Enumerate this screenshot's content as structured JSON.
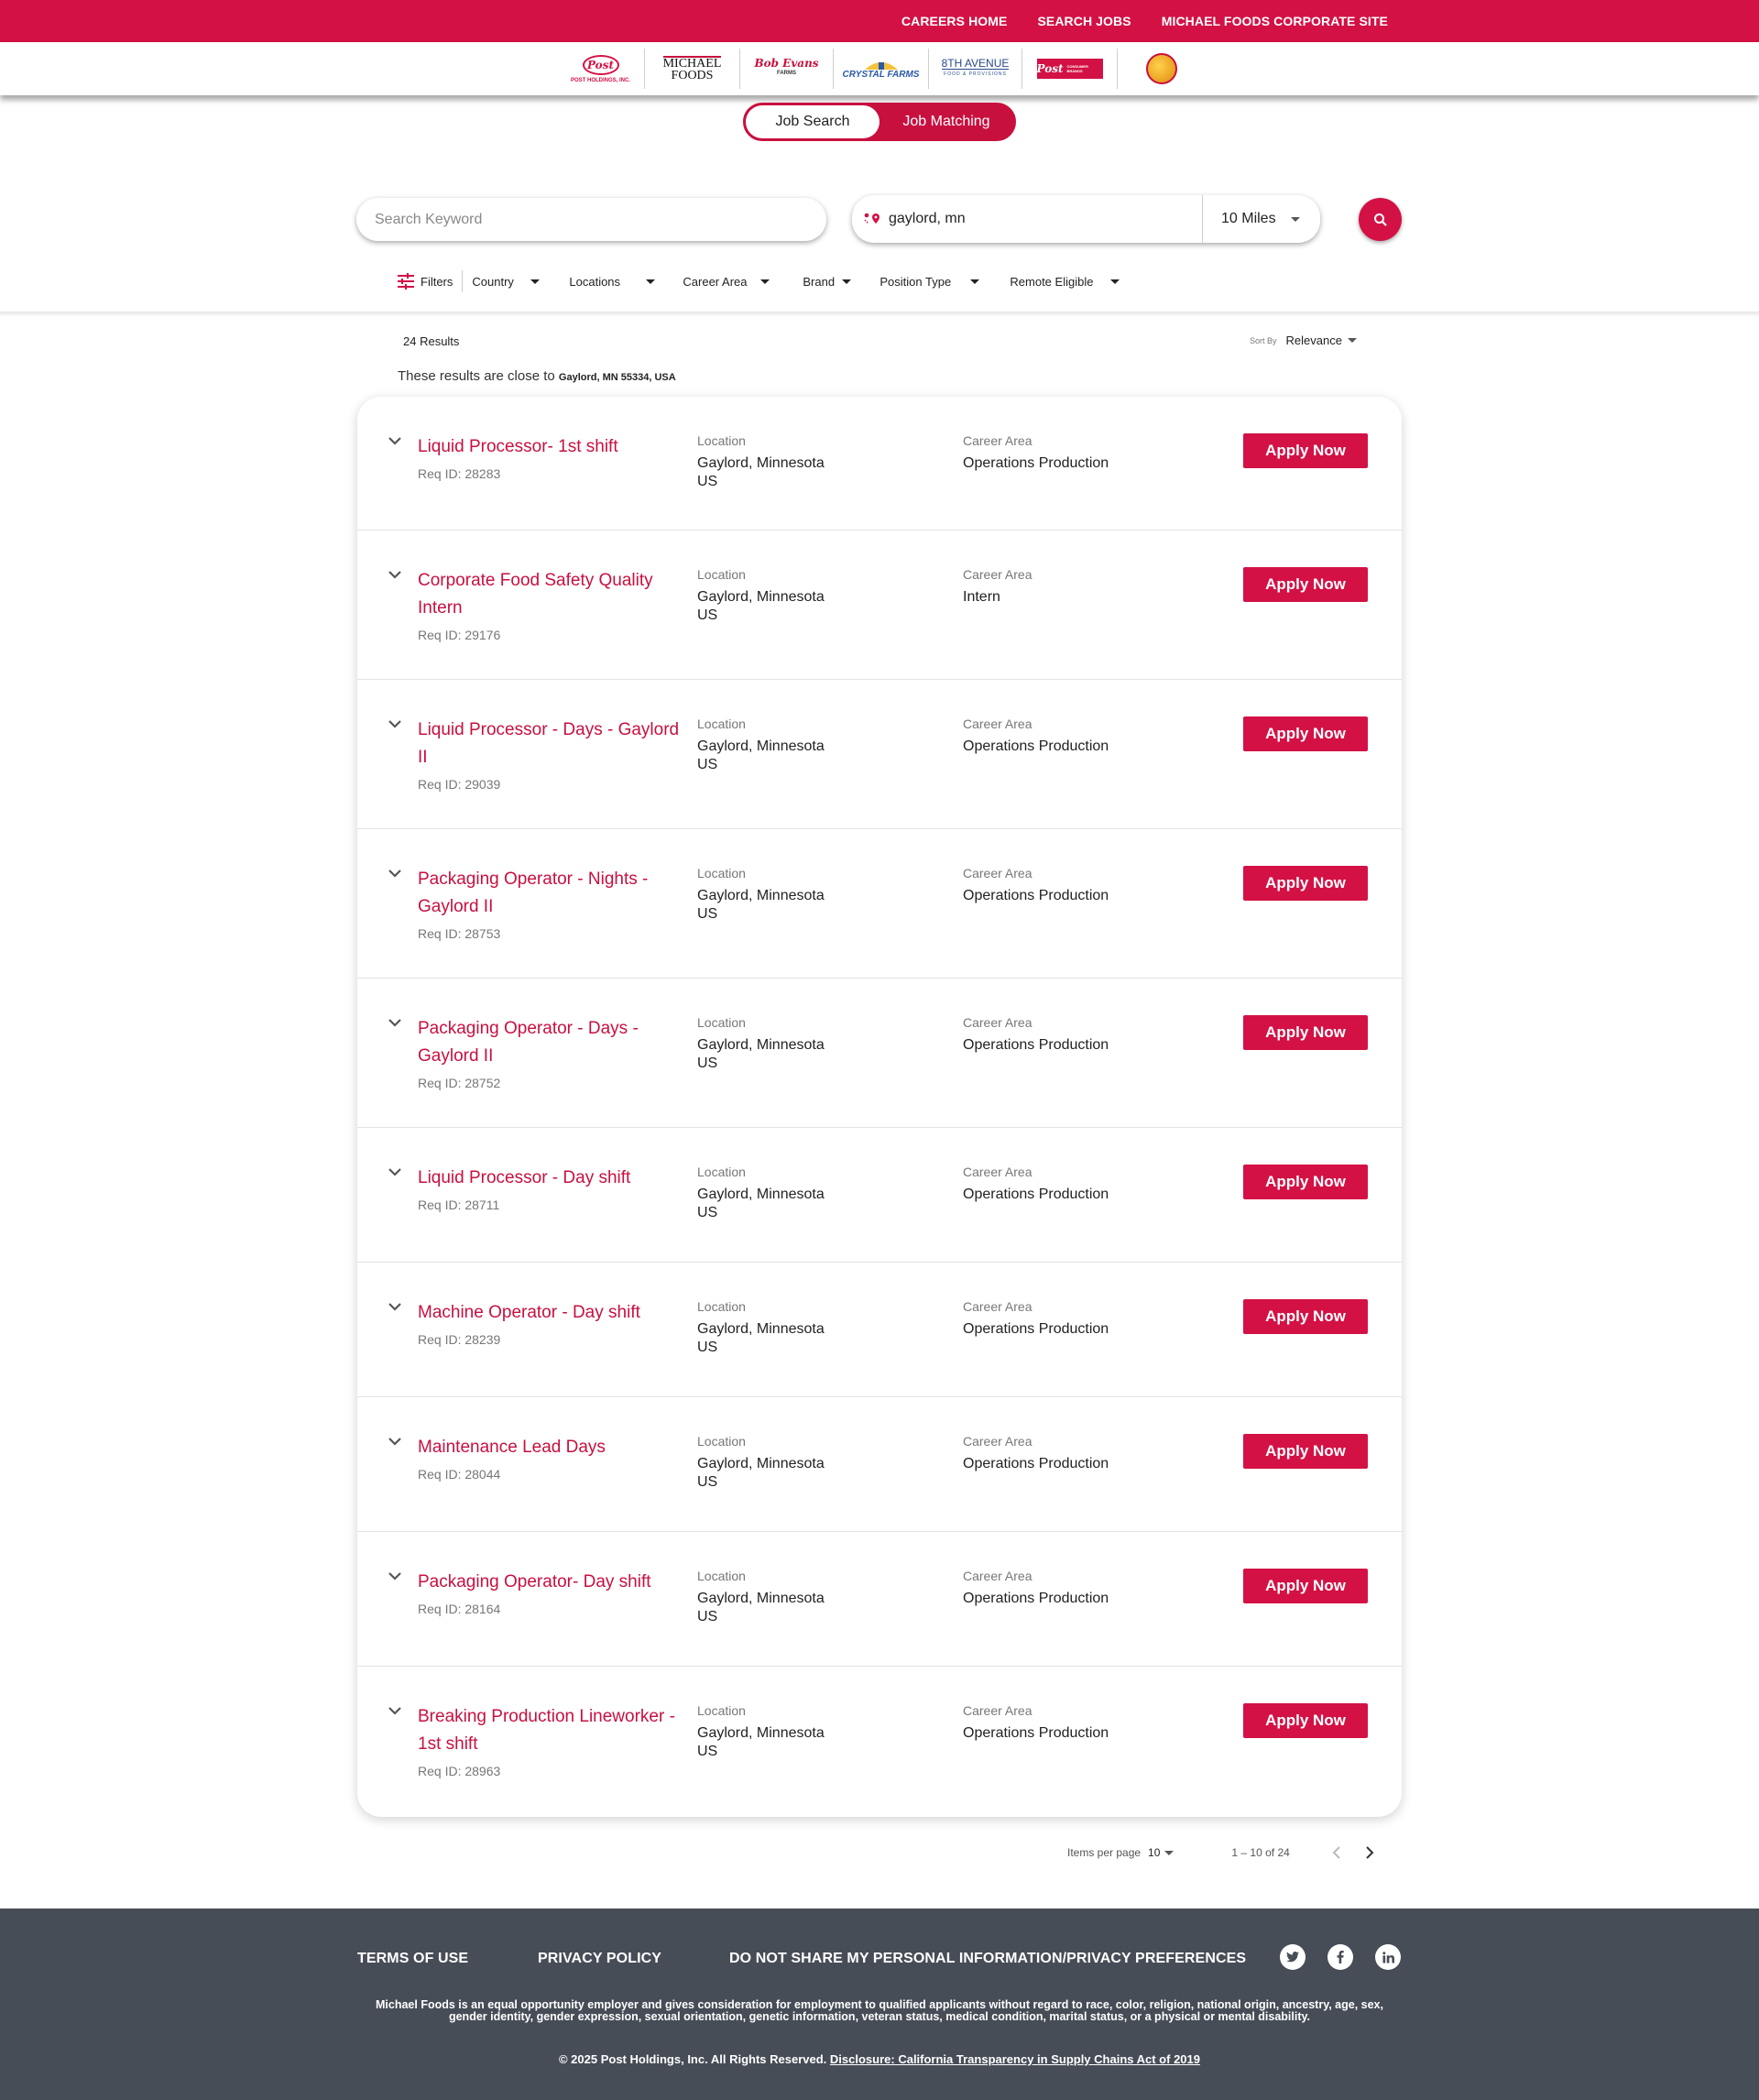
{
  "topnav": [
    "CAREERS HOME",
    "SEARCH JOBS",
    "MICHAEL FOODS CORPORATE SITE"
  ],
  "brands": {
    "post_holdings": "POST HOLDINGS, INC.",
    "michael_foods_1": "MICHAEL",
    "michael_foods_2": "FOODS",
    "bob_evans_1": "Bob Evans",
    "bob_evans_2": "FARMS",
    "crystal_farms": "CRYSTAL FARMS",
    "eighth_avenue_1": "8TH AVENUE",
    "eighth_avenue_2": "FOOD & PROVISIONS",
    "post_consumer": "Post",
    "post_consumer_small": "CONSUMER BRANDS"
  },
  "toggle": {
    "job_search": "Job Search",
    "job_matching": "Job Matching"
  },
  "search": {
    "keyword_placeholder": "Search Keyword",
    "location_value": "gaylord, mn",
    "radius": "10 Miles"
  },
  "filters": {
    "label": "Filters",
    "items": [
      "Country",
      "Locations",
      "Career Area",
      "Brand",
      "Position Type",
      "Remote Eligible"
    ]
  },
  "results": {
    "count": "24 Results",
    "sort_label": "Sort By",
    "sort_value": "Relevance",
    "close_prefix": "These results are close to",
    "close_place": "Gaylord, MN 55334, USA"
  },
  "labels": {
    "location": "Location",
    "career_area": "Career Area",
    "apply": "Apply Now"
  },
  "jobs": [
    {
      "title": "Liquid Processor- 1st shift",
      "req": "Req ID: 28283",
      "loc1": "Gaylord, Minnesota",
      "loc2": "US",
      "area": "Operations Production"
    },
    {
      "title": "Corporate Food Safety Quality Intern",
      "req": "Req ID: 29176",
      "loc1": "Gaylord, Minnesota",
      "loc2": "US",
      "area": "Intern"
    },
    {
      "title": "Liquid Processor - Days - Gaylord II",
      "req": "Req ID: 29039",
      "loc1": "Gaylord, Minnesota",
      "loc2": "US",
      "area": "Operations Production"
    },
    {
      "title": "Packaging Operator - Nights - Gaylord II",
      "req": "Req ID: 28753",
      "loc1": "Gaylord, Minnesota",
      "loc2": "US",
      "area": "Operations Production"
    },
    {
      "title": "Packaging Operator - Days - Gaylord II",
      "req": "Req ID: 28752",
      "loc1": "Gaylord, Minnesota",
      "loc2": "US",
      "area": "Operations Production"
    },
    {
      "title": "Liquid Processor - Day shift",
      "req": "Req ID: 28711",
      "loc1": "Gaylord, Minnesota",
      "loc2": "US",
      "area": "Operations Production"
    },
    {
      "title": "Machine Operator - Day shift",
      "req": "Req ID: 28239",
      "loc1": "Gaylord, Minnesota",
      "loc2": "US",
      "area": "Operations Production"
    },
    {
      "title": "Maintenance Lead Days",
      "req": "Req ID: 28044",
      "loc1": "Gaylord, Minnesota",
      "loc2": "US",
      "area": "Operations Production"
    },
    {
      "title": "Packaging Operator- Day shift",
      "req": "Req ID: 28164",
      "loc1": "Gaylord, Minnesota",
      "loc2": "US",
      "area": "Operations Production"
    },
    {
      "title": "Breaking Production Lineworker - 1st shift",
      "req": "Req ID: 28963",
      "loc1": "Gaylord, Minnesota",
      "loc2": "US",
      "area": "Operations Production"
    }
  ],
  "pager": {
    "items_label": "Items per page",
    "items_value": "10",
    "range": "1 – 10 of 24"
  },
  "footer": {
    "links": [
      "TERMS OF USE",
      "PRIVACY POLICY",
      "DO NOT SHARE MY PERSONAL INFORMATION/PRIVACY PREFERENCES"
    ],
    "eeo": "Michael Foods is an equal opportunity employer and gives consideration for employment to qualified applicants without regard to race, color, religion, national origin, ancestry, age, sex, gender identity, gender expression, sexual orientation, genetic information, veteran status, medical condition, marital status, or a physical or mental disability.",
    "copyright": "© 2025 Post Holdings, Inc. All Rights Reserved.",
    "disclosure": "Disclosure: California Transparency in Supply Chains Act of 2019"
  },
  "colors": {
    "brand_red": "#d31145",
    "title_red": "#c8103f",
    "footer_bg": "#474d57"
  }
}
